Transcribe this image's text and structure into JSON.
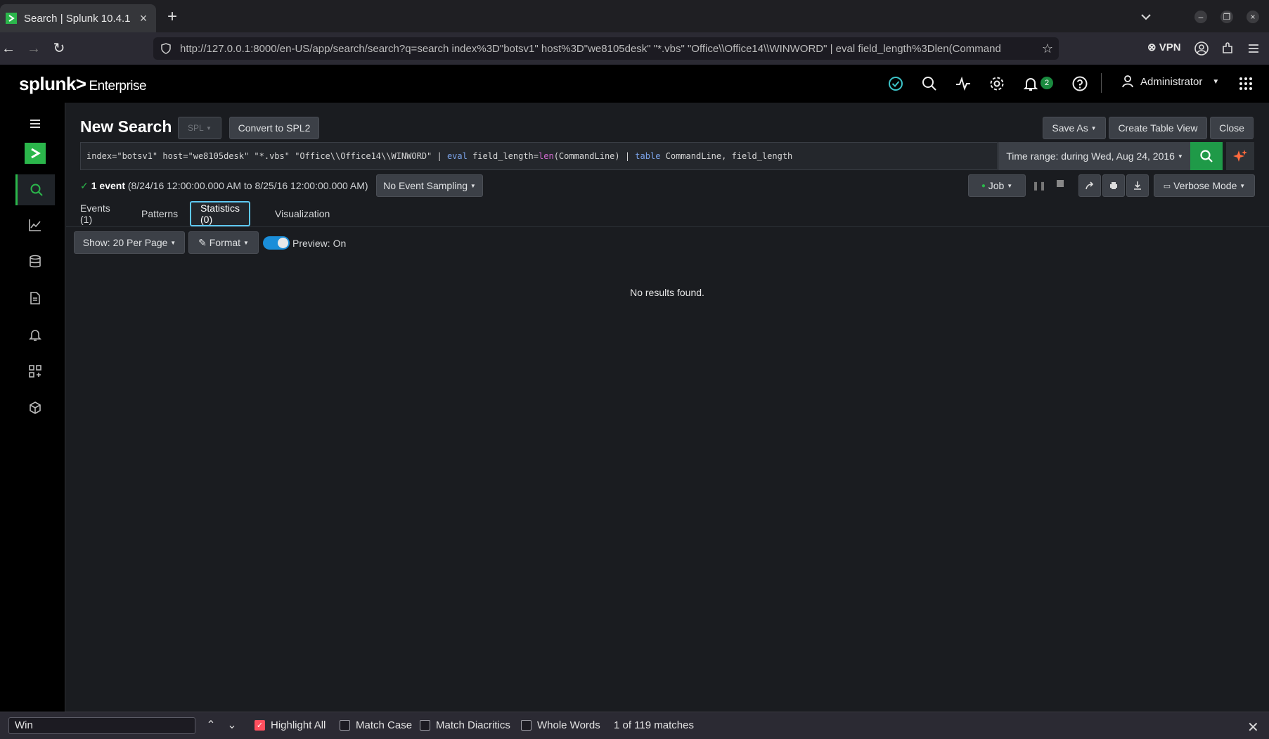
{
  "browser": {
    "tab_title": "Search | Splunk 10.4.1",
    "url": "http://127.0.0.1:8000/en-US/app/search/search?q=search index%3D\"botsv1\" host%3D\"we8105desk\" \"*.vbs\" \"Office\\\\Office14\\\\WINWORD\" | eval field_length%3Dlen(Command",
    "vpn_label": "VPN"
  },
  "header": {
    "logo": "splunk>",
    "product": "Enterprise",
    "notification_count": "2",
    "user": "Administrator"
  },
  "search": {
    "page_title": "New Search",
    "spl_label": "SPL",
    "convert_label": "Convert to SPL2",
    "save_as_label": "Save As",
    "create_table_label": "Create Table View",
    "close_label": "Close",
    "query_part1": "index=\"botsv1\" host=\"we8105desk\" \"*.vbs\" \"Office\\\\Office14\\\\WINWORD\" | ",
    "query_kw1": "eval",
    "query_part2": " field_length=",
    "query_fn": "len",
    "query_part3": "(CommandLine) | ",
    "query_kw2": "table",
    "query_part4": " CommandLine, field_length",
    "time_range": "Time range: during Wed, Aug 24, 2016"
  },
  "job": {
    "event_count": "1 event",
    "event_range": " (8/24/16 12:00:00.000 AM to 8/25/16 12:00:00.000 AM)",
    "sampling_label": "No Event Sampling",
    "job_label": "Job",
    "mode_label": "Verbose Mode"
  },
  "results": {
    "tabs": [
      "Events (1)",
      "Patterns",
      "Statistics (0)",
      "Visualization"
    ],
    "active_tab": "Statistics (0)",
    "show_label": "Show: 20 Per Page",
    "format_label": "Format",
    "preview_label": "Preview: On",
    "empty_message": "No results found."
  },
  "findbar": {
    "query": "Win",
    "highlight_all": "Highlight All",
    "match_case": "Match Case",
    "match_diacritics": "Match Diacritics",
    "whole_words": "Whole Words",
    "match_count": "1 of 119 matches"
  },
  "colors": {
    "accent_green": "#2bb64b",
    "active_tab_border": "#5ec8f2",
    "toggle_blue": "#1a8ed9"
  }
}
